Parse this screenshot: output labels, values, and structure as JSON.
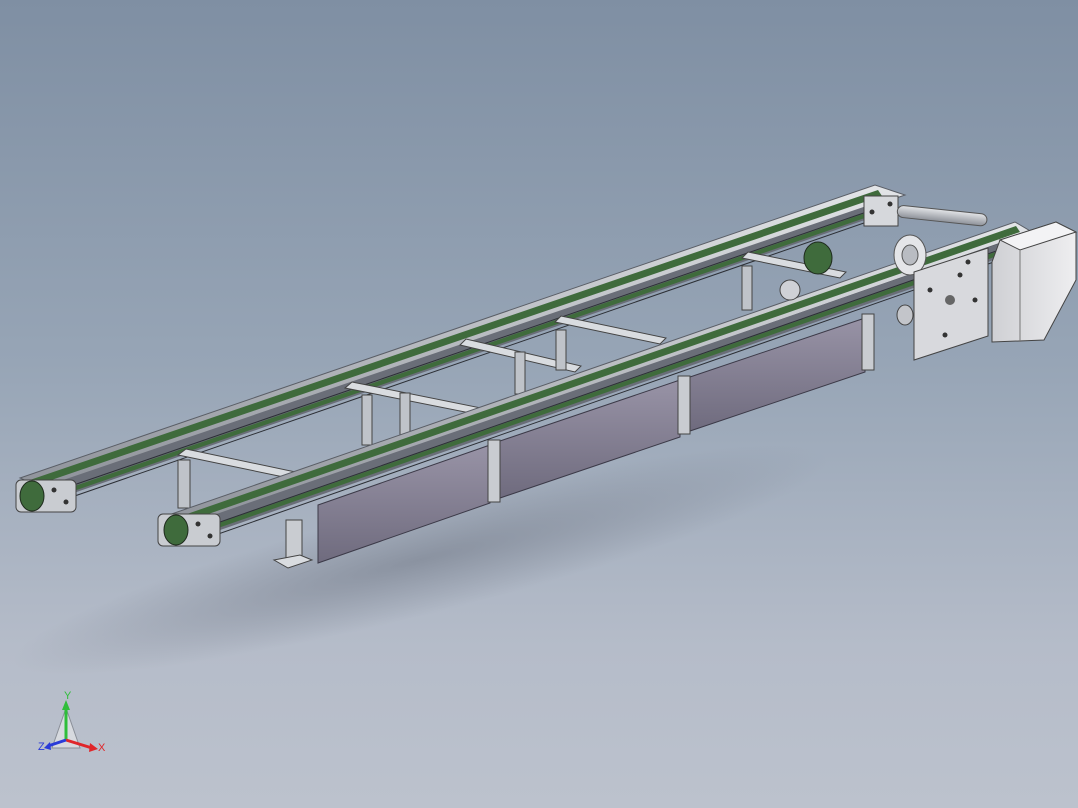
{
  "viewport": {
    "background_top": "#7f8fa3",
    "background_bottom": "#bcc2cd"
  },
  "model": {
    "frame_color": "#c4c8ce",
    "belt_color": "#3f6b3c",
    "panel_color": "#8e8a9c",
    "motor_color": "#d9dadd"
  },
  "triad": {
    "x_label": "X",
    "y_label": "Y",
    "z_label": "Z",
    "x_color": "#e0262a",
    "y_color": "#2fbe3a",
    "z_color": "#2a3bd8"
  }
}
